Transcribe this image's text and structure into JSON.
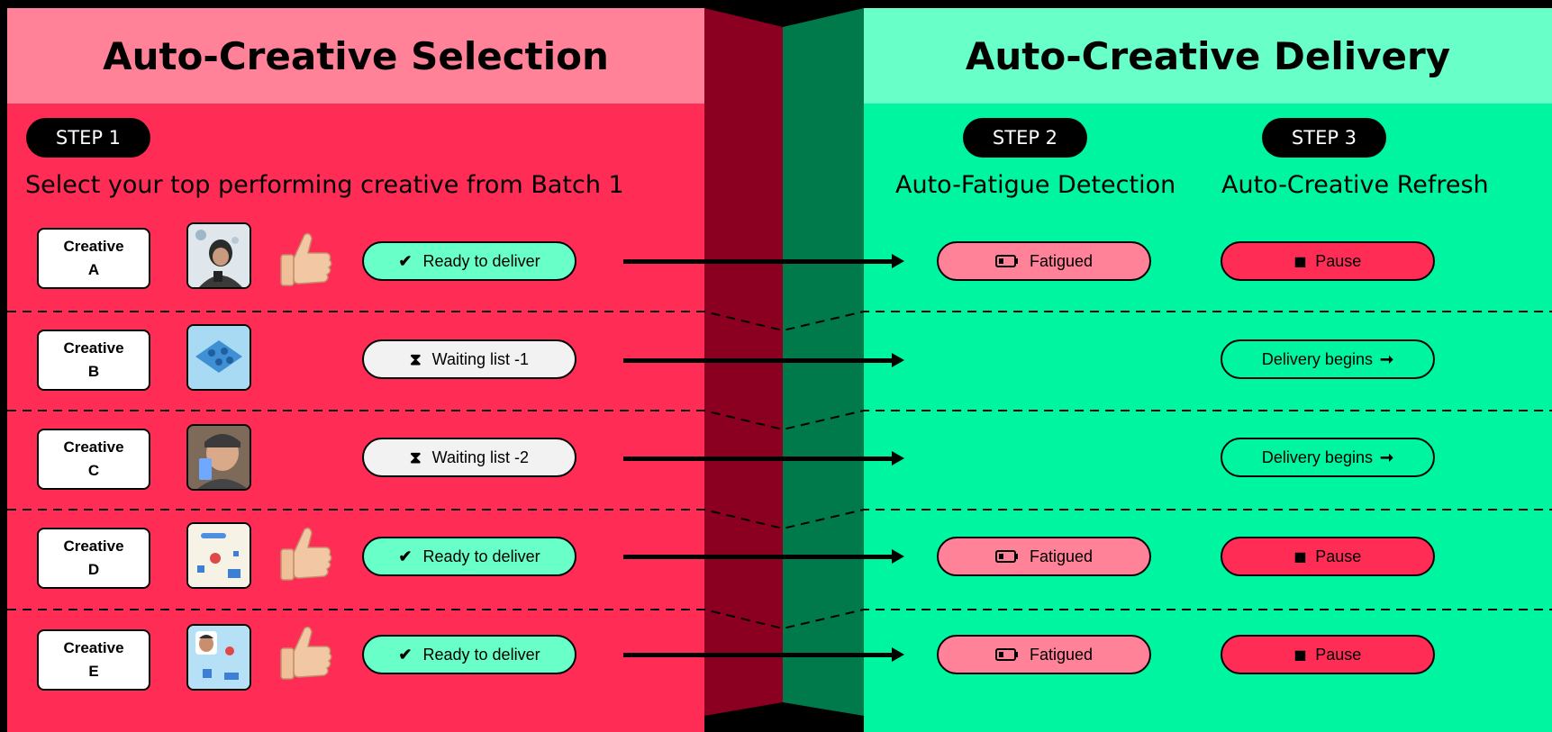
{
  "left_section": {
    "title": "Auto-Creative Selection",
    "step_label": "STEP 1",
    "subtitle": "Select your top performing creative from Batch 1"
  },
  "right_section": {
    "title": "Auto-Creative Delivery",
    "step2_label": "STEP 2",
    "step2_title": "Auto-Fatigue Detection",
    "step3_label": "STEP 3",
    "step3_title": "Auto-Creative Refresh"
  },
  "colors": {
    "selection_red": "#ff2d55",
    "selection_header": "#ff8298",
    "delivery_green": "#00f5a0",
    "delivery_header": "#68ffc8",
    "fatigued_pink": "#ff8298",
    "pause_red": "#ff2d55",
    "ready_mint": "#68ffc8",
    "waiting_gray": "#f2f2f2"
  },
  "rows": [
    {
      "creative_line1": "Creative",
      "creative_line2": "A",
      "thumbnail": "person-holding-phone",
      "thumbs_up": true,
      "status_icon": "checkmark-icon",
      "status_glyph": "✔",
      "status": "Ready to deliver",
      "fatigue_icon": "battery-low-icon",
      "fatigue": "Fatigued",
      "refresh_icon": "pause-icon",
      "refresh_glyph": "▮▮",
      "refresh": "Pause"
    },
    {
      "creative_line1": "Creative",
      "creative_line2": "B",
      "thumbnail": "blue-game-board",
      "thumbs_up": false,
      "status_icon": "hourglass-icon",
      "status_glyph": "⧗",
      "status": "Waiting list -1",
      "fatigue": "",
      "refresh_icon": "arrow-right-icon",
      "refresh_glyph": "➞",
      "refresh": "Delivery begins"
    },
    {
      "creative_line1": "Creative",
      "creative_line2": "C",
      "thumbnail": "person-with-phone-selfie",
      "thumbs_up": false,
      "status_icon": "hourglass-icon",
      "status_glyph": "⧗",
      "status": "Waiting list -2",
      "fatigue": "",
      "refresh_icon": "arrow-right-icon",
      "refresh_glyph": "➞",
      "refresh": "Delivery begins"
    },
    {
      "creative_line1": "Creative",
      "creative_line2": "D",
      "thumbnail": "game-screen",
      "thumbs_up": true,
      "status_icon": "checkmark-icon",
      "status_glyph": "✔",
      "status": "Ready to deliver",
      "fatigue_icon": "battery-low-icon",
      "fatigue": "Fatigued",
      "refresh_icon": "pause-icon",
      "refresh_glyph": "▮▮",
      "refresh": "Pause"
    },
    {
      "creative_line1": "Creative",
      "creative_line2": "E",
      "thumbnail": "game-with-face",
      "thumbs_up": true,
      "status_icon": "checkmark-icon",
      "status_glyph": "✔",
      "status": "Ready to deliver",
      "fatigue_icon": "battery-low-icon",
      "fatigue": "Fatigued",
      "refresh_icon": "pause-icon",
      "refresh_glyph": "▮▮",
      "refresh": "Pause"
    }
  ]
}
